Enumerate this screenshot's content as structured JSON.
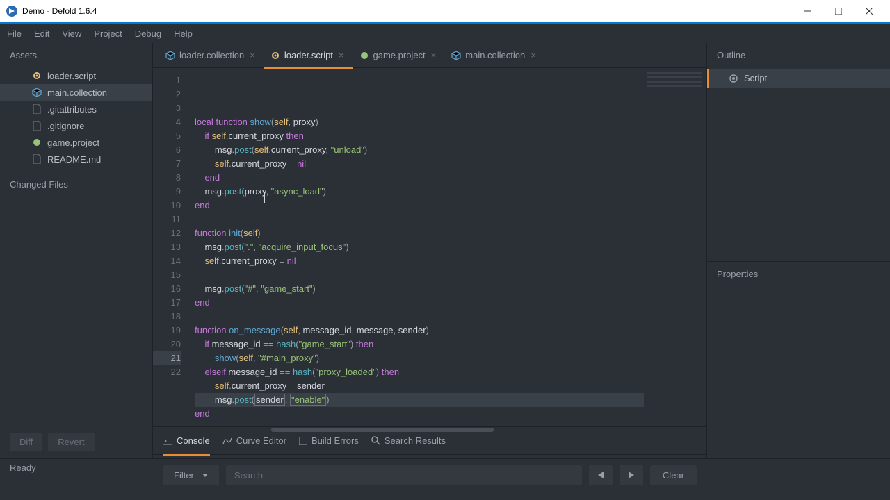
{
  "window": {
    "title": "Demo - Defold 1.6.4"
  },
  "menu": {
    "items": [
      "File",
      "Edit",
      "View",
      "Project",
      "Debug",
      "Help"
    ]
  },
  "assets": {
    "title": "Assets",
    "items": [
      {
        "name": "loader.script",
        "icon": "gear",
        "sel": false
      },
      {
        "name": "main.collection",
        "icon": "cube",
        "sel": true
      },
      {
        "name": ".gitattributes",
        "icon": "file",
        "sel": false
      },
      {
        "name": ".gitignore",
        "icon": "file",
        "sel": false
      },
      {
        "name": "game.project",
        "icon": "proj",
        "sel": false
      },
      {
        "name": "README.md",
        "icon": "file",
        "sel": false
      }
    ]
  },
  "changed": {
    "title": "Changed Files"
  },
  "left_buttons": {
    "diff": "Diff",
    "revert": "Revert"
  },
  "tabs": [
    {
      "label": "loader.collection",
      "icon": "cube",
      "active": false
    },
    {
      "label": "loader.script",
      "icon": "gear",
      "active": true
    },
    {
      "label": "game.project",
      "icon": "proj",
      "active": false
    },
    {
      "label": "main.collection",
      "icon": "cube",
      "active": false
    }
  ],
  "code": {
    "lines": [
      {
        "n": 1,
        "html": "<span class='kw'>local</span> <span class='kw'>function</span> <span class='fn'>show</span><span class='pn'>(</span><span class='self'>self</span><span class='pn'>,</span> proxy<span class='pn'>)</span>"
      },
      {
        "n": 2,
        "html": "    <span class='kw'>if</span> <span class='self'>self</span><span class='pn'>.</span>current_proxy <span class='kw'>then</span>"
      },
      {
        "n": 3,
        "html": "        msg<span class='pn'>.</span><span class='call'>post</span><span class='pn'>(</span><span class='self'>self</span><span class='pn'>.</span>current_proxy<span class='pn'>,</span> <span class='str'>\"unload\"</span><span class='pn'>)</span>"
      },
      {
        "n": 4,
        "html": "        <span class='self'>self</span><span class='pn'>.</span>current_proxy <span class='pn'>=</span> <span class='kw'>nil</span>"
      },
      {
        "n": 5,
        "html": "    <span class='kw'>end</span>"
      },
      {
        "n": 6,
        "html": "    msg<span class='pn'>.</span><span class='call'>post</span><span class='pn'>(</span>proxy<span class='pn'>,</span> <span class='str'>\"async_load\"</span><span class='pn'>)</span>"
      },
      {
        "n": 7,
        "html": "<span class='kw'>end</span>"
      },
      {
        "n": 8,
        "html": ""
      },
      {
        "n": 9,
        "html": "<span class='kw'>function</span> <span class='fn'>init</span><span class='pn'>(</span><span class='self'>self</span><span class='pn'>)</span>"
      },
      {
        "n": 10,
        "html": "    msg<span class='pn'>.</span><span class='call'>post</span><span class='pn'>(</span><span class='str'>\".\"</span><span class='pn'>,</span> <span class='str'>\"acquire_input_focus\"</span><span class='pn'>)</span>"
      },
      {
        "n": 11,
        "html": "    <span class='self'>self</span><span class='pn'>.</span>current_proxy <span class='pn'>=</span> <span class='kw'>nil</span>"
      },
      {
        "n": 12,
        "html": ""
      },
      {
        "n": 13,
        "html": "    msg<span class='pn'>.</span><span class='call'>post</span><span class='pn'>(</span><span class='str'>\"#\"</span><span class='pn'>,</span> <span class='str'>\"game_start\"</span><span class='pn'>)</span>"
      },
      {
        "n": 14,
        "html": "<span class='kw'>end</span>"
      },
      {
        "n": 15,
        "html": ""
      },
      {
        "n": 16,
        "html": "<span class='kw'>function</span> <span class='fn'>on_message</span><span class='pn'>(</span><span class='self'>self</span><span class='pn'>,</span> message_id<span class='pn'>,</span> message<span class='pn'>,</span> sender<span class='pn'>)</span>"
      },
      {
        "n": 17,
        "html": "    <span class='kw'>if</span> message_id <span class='pn'>==</span> <span class='call'>hash</span><span class='pn'>(</span><span class='str'>\"game_start\"</span><span class='pn'>)</span> <span class='kw'>then</span>"
      },
      {
        "n": 18,
        "html": "        <span class='fn'>show</span><span class='pn'>(</span><span class='self'>self</span><span class='pn'>,</span> <span class='str'>\"#main_proxy\"</span><span class='pn'>)</span>"
      },
      {
        "n": 19,
        "html": "    <span class='kw'>elseif</span> message_id <span class='pn'>==</span> <span class='call'>hash</span><span class='pn'>(</span><span class='str'>\"proxy_loaded\"</span><span class='pn'>)</span> <span class='kw'>then</span>"
      },
      {
        "n": 20,
        "html": "        <span class='self'>self</span><span class='pn'>.</span>current_proxy <span class='pn'>=</span> sender"
      },
      {
        "n": 21,
        "cur": true,
        "html": "        msg<span class='pn'>.</span><span class='call'>post</span><span class='pn'>(</span><span class='boxhl'>sender</span><span class='pn'>,</span> <span class='boxhl'><span class='str'>\"enable\"</span></span><span class='pn'>)</span>"
      },
      {
        "n": 22,
        "html": "<span class='kw'>end</span>"
      }
    ]
  },
  "bottom_tabs": [
    {
      "label": "Console",
      "icon": "console",
      "active": true
    },
    {
      "label": "Curve Editor",
      "icon": "curve",
      "active": false
    },
    {
      "label": "Build Errors",
      "icon": "errors",
      "active": false
    },
    {
      "label": "Search Results",
      "icon": "search",
      "active": false
    }
  ],
  "console": {
    "filter": "Filter",
    "search_placeholder": "Search",
    "clear": "Clear"
  },
  "outline": {
    "title": "Outline",
    "item": "Script"
  },
  "properties": {
    "title": "Properties"
  },
  "status": {
    "text": "Ready"
  }
}
